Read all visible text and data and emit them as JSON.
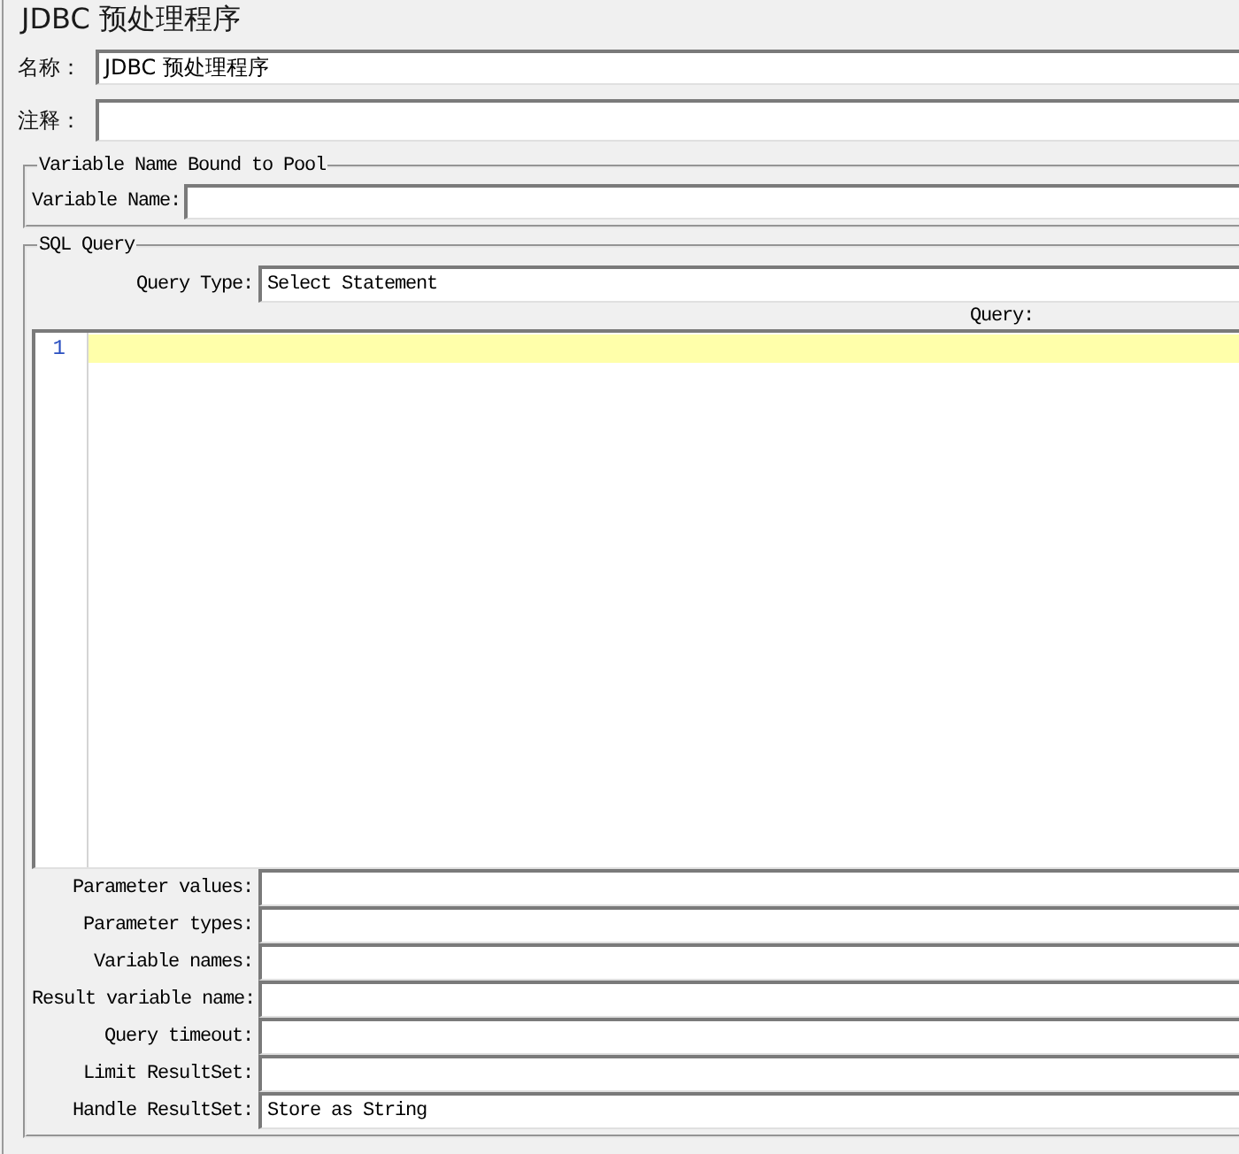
{
  "title": "JDBC 预处理程序",
  "fields": [
    {
      "label": "名称：",
      "value": "JDBC 预处理程序",
      "kind": "text"
    },
    {
      "label": "注释：",
      "kind": "textarea"
    }
  ],
  "pool_group": {
    "legend": "Variable Name Bound to Pool",
    "fields": [
      {
        "label": "Variable Name:"
      }
    ]
  },
  "sql_group": {
    "legend": "SQL Query",
    "query_type": {
      "label": "Query Type:",
      "value": "Select Statement"
    },
    "query_editor": {
      "label": "Query:",
      "lines": [
        {
          "number": "1",
          "current": true
        }
      ]
    },
    "fields": [
      {
        "label": "Parameter values:"
      },
      {
        "label": "Parameter types:"
      },
      {
        "label": "Variable names:"
      },
      {
        "label": "Result variable name:"
      },
      {
        "label": "Query timeout:"
      },
      {
        "label": "Limit ResultSet:"
      },
      {
        "label": "Handle ResultSet:",
        "value": "Store as String"
      }
    ]
  }
}
